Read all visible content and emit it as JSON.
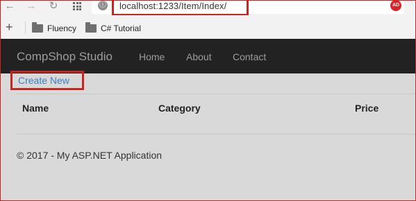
{
  "browser": {
    "url": "localhost:1233/Item/Index/",
    "site_icon": "ⓘ",
    "extension_badge": "AD",
    "icons": [
      "back-arrow-icon",
      "forward-arrow-icon",
      "reload-icon",
      "apps-grid-icon",
      "site-info-icon"
    ],
    "back_glyph": "←",
    "forward_glyph": "→",
    "reload_glyph": "↻"
  },
  "bookmarks": {
    "add_glyph": "+",
    "items": [
      {
        "label": "Fluency",
        "icon": "folder-icon"
      },
      {
        "label": "C# Tutorial",
        "icon": "folder-icon"
      }
    ]
  },
  "navbar": {
    "brand": "CompShop Studio",
    "links": [
      "Home",
      "About",
      "Contact"
    ]
  },
  "main": {
    "create_link": "Create New",
    "table": {
      "headers": [
        "Name",
        "Category",
        "Price"
      ]
    }
  },
  "footer": {
    "text": "© 2017 - My ASP.NET Application"
  },
  "colors": {
    "highlight_red": "#c82520",
    "navbar_bg": "#222222",
    "link_blue": "#3b7fc4",
    "page_bg": "#d9d9d9"
  }
}
